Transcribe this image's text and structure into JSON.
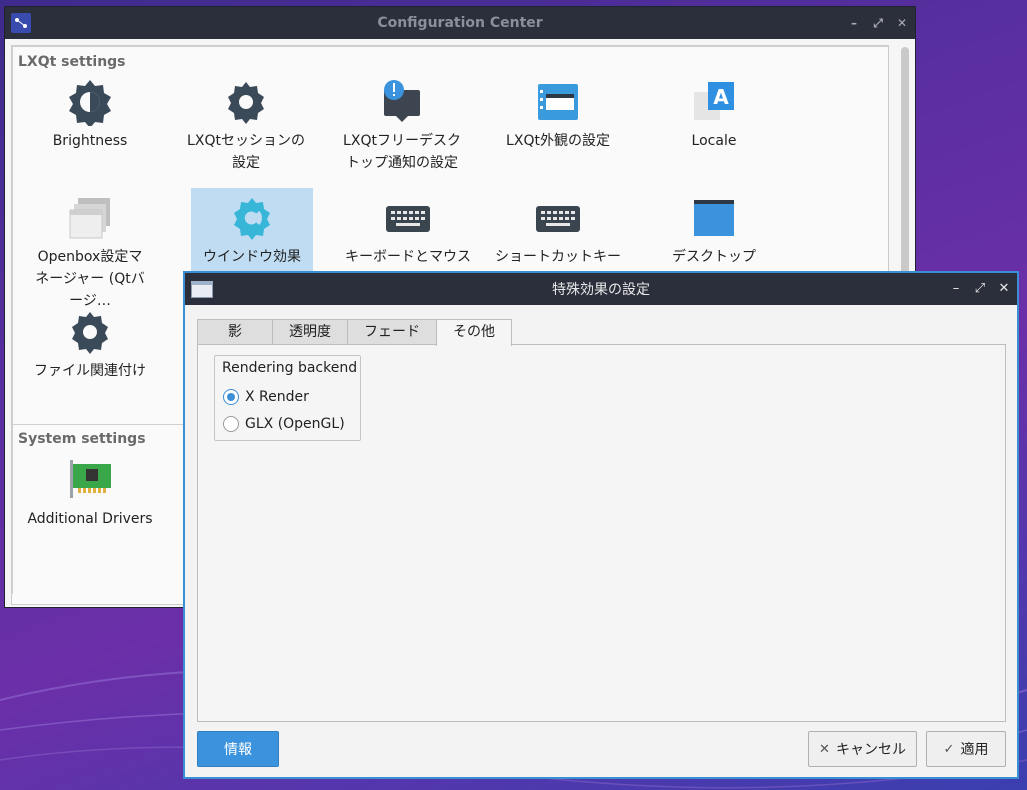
{
  "config_center": {
    "title": "Configuration Center",
    "lxqt_section": "LXQt settings",
    "system_section": "System settings",
    "lxqt_items": [
      {
        "label": "Brightness",
        "icon": "brightness-icon"
      },
      {
        "label": "LXQtセッションの設定",
        "icon": "gear-icon"
      },
      {
        "label": "LXQtフリーデスクトップ通知の設定",
        "icon": "notification-icon"
      },
      {
        "label": "LXQt外観の設定",
        "icon": "appearance-icon"
      },
      {
        "label": "Locale",
        "icon": "locale-icon"
      },
      {
        "label": "Openbox設定マネージャー (Qtバージ…",
        "icon": "openbox-icon"
      },
      {
        "label": "ウインドウ効果",
        "icon": "window-effects-icon"
      },
      {
        "label": "キーボードとマウス",
        "icon": "keyboard-icon"
      },
      {
        "label": "ショートカットキー",
        "icon": "keyboard-icon"
      },
      {
        "label": "デスクトップ",
        "icon": "desktop-icon"
      },
      {
        "label": "ファイル関連付け",
        "icon": "gear-icon"
      }
    ],
    "system_items": [
      {
        "label": "Additional Drivers",
        "icon": "pci-card-icon"
      }
    ]
  },
  "dialog": {
    "title": "特殊効果の設定",
    "tabs": [
      "影",
      "透明度",
      "フェード",
      "その他"
    ],
    "active_tab": "その他",
    "group_title": "Rendering backend",
    "options": [
      {
        "label": "X Render",
        "checked": true
      },
      {
        "label": "GLX (OpenGL)",
        "checked": false
      }
    ],
    "buttons": {
      "info": "情報",
      "cancel": "キャンセル",
      "apply": "適用"
    }
  },
  "colors": {
    "accent": "#3a93dc",
    "titlebar": "#2b2f3b",
    "selection": "#bfdcf3"
  }
}
